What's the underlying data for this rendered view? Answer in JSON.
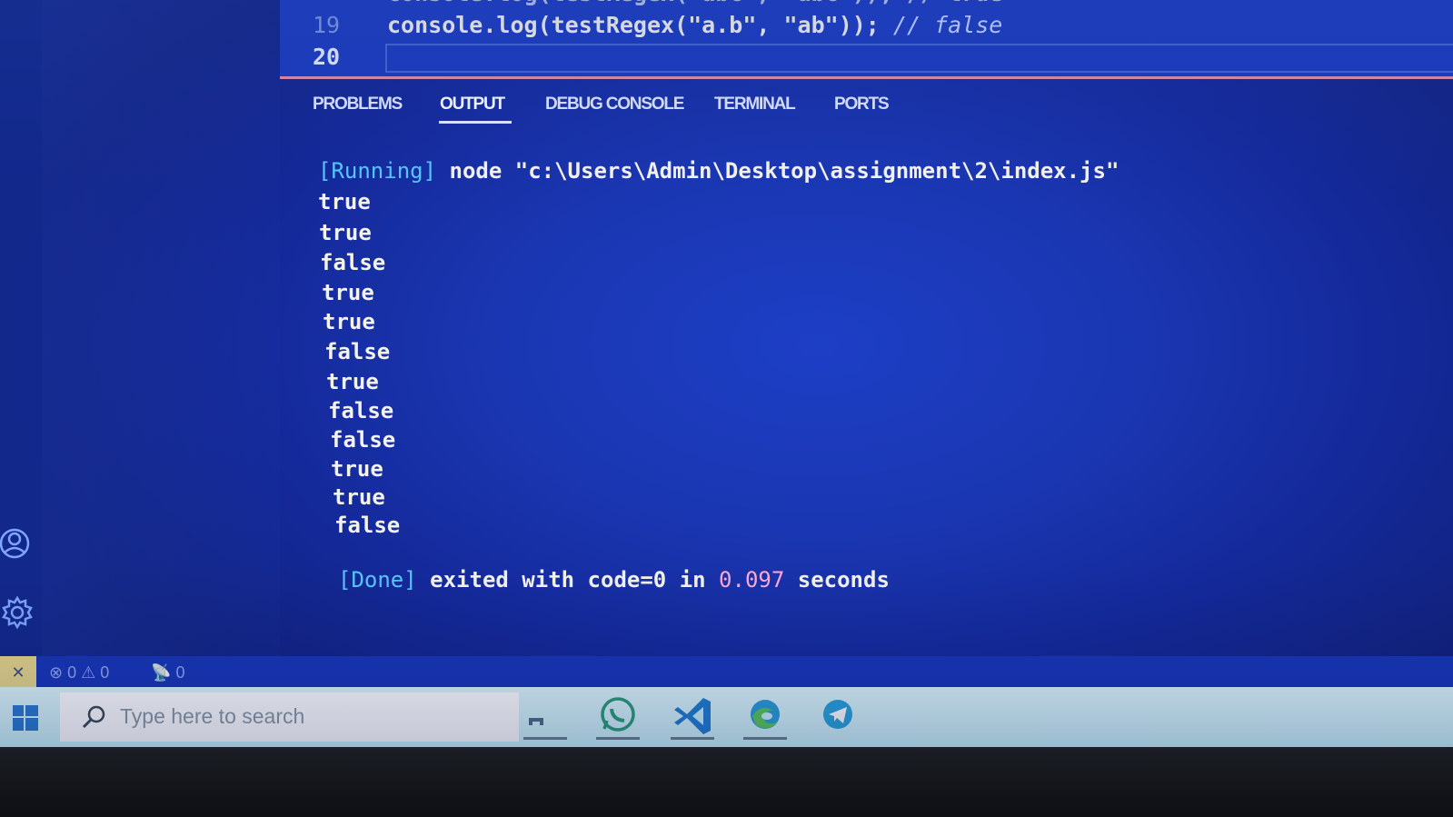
{
  "editor": {
    "lines": [
      {
        "number": "19",
        "code": "console.log(testRegex(\"a.b\", \"ab\")); ",
        "comment": "// false"
      },
      {
        "number": "20",
        "code": "",
        "comment": ""
      }
    ]
  },
  "panel": {
    "tabs": [
      "PROBLEMS",
      "OUTPUT",
      "DEBUG CONSOLE",
      "TERMINAL",
      "PORTS"
    ],
    "active_tab": "OUTPUT"
  },
  "output": {
    "running_tag": "[Running]",
    "running_command": " node \"c:\\Users\\Admin\\Desktop\\assignment\\2\\index.js\"",
    "results": [
      "true",
      "true",
      "false",
      "true",
      "true",
      "false",
      "true",
      "false",
      "false",
      "true",
      "true",
      "false"
    ],
    "done_tag": "[Done]",
    "done_prefix": " exited with code=0 in ",
    "done_time": "0.097",
    "done_suffix": " seconds"
  },
  "status_bar": {
    "errors": "0",
    "warnings": "0",
    "ports": "0"
  },
  "taskbar": {
    "search_placeholder": "Type here to search",
    "apps": [
      "file-explorer",
      "whatsapp",
      "vscode",
      "edge",
      "telegram"
    ]
  },
  "colors": {
    "background": "#1a36b1",
    "output_tag": "#58c8ff",
    "time_value": "#ffa9d6",
    "panel_border": "#e08fa8"
  }
}
